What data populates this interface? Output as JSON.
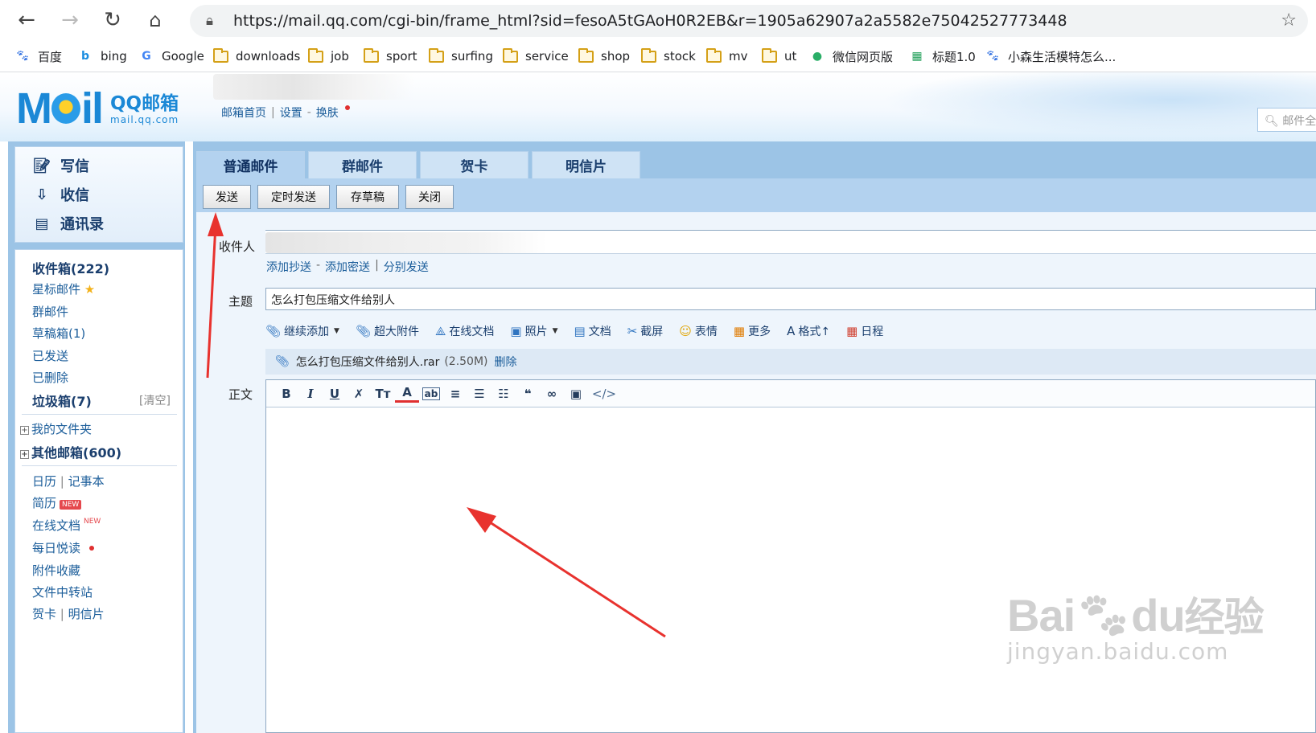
{
  "browser": {
    "url": "https://mail.qq.com/cgi-bin/frame_html?sid=fesoA5tGAoH0R2EB&r=1905a62907a2a5582e75042527773448",
    "bookmarks": [
      {
        "label": "百度",
        "icon": "baidu-paw-icon"
      },
      {
        "label": "bing",
        "icon": "bing-icon"
      },
      {
        "label": "Google",
        "icon": "google-icon"
      },
      {
        "label": "downloads",
        "icon": "folder-icon"
      },
      {
        "label": "job",
        "icon": "folder-icon"
      },
      {
        "label": "sport",
        "icon": "folder-icon"
      },
      {
        "label": "surfing",
        "icon": "folder-icon"
      },
      {
        "label": "service",
        "icon": "folder-icon"
      },
      {
        "label": "shop",
        "icon": "folder-icon"
      },
      {
        "label": "stock",
        "icon": "folder-icon"
      },
      {
        "label": "mv",
        "icon": "folder-icon"
      },
      {
        "label": "ut",
        "icon": "folder-icon"
      },
      {
        "label": "微信网页版",
        "icon": "wechat-icon"
      },
      {
        "label": "标题1.0",
        "icon": "sheet-icon"
      },
      {
        "label": "小森生活模特怎么...",
        "icon": "baidu-paw-icon"
      }
    ]
  },
  "header": {
    "logo_mail": "M",
    "logo_il": "il",
    "logo_name": "QQ邮箱",
    "logo_domain": "mail.qq.com",
    "links": {
      "home": "邮箱首页",
      "settings": "设置",
      "skin": "换肤"
    },
    "search_placeholder": "邮件全"
  },
  "sidebar": {
    "quick": {
      "compose": "写信",
      "inbox": "收信",
      "contacts": "通讯录"
    },
    "folders": {
      "inbox": "收件箱(222)",
      "starred": "星标邮件",
      "group": "群邮件",
      "drafts": "草稿箱(1)",
      "sent": "已发送",
      "deleted": "已删除",
      "spam": "垃圾箱(7)",
      "spam_clear": "[清空]",
      "my_folders": "我的文件夹",
      "other_mailboxes": "其他邮箱(600)"
    },
    "apps": {
      "calendar": "日历",
      "notes": "记事本",
      "resume": "简历",
      "resume_badge": "NEW",
      "docs": "在线文档",
      "docs_badge": "NEW",
      "daily": "每日悦读",
      "attachments": "附件收藏",
      "transfer": "文件中转站",
      "cards": "贺卡",
      "postcards": "明信片"
    }
  },
  "compose": {
    "tabs": [
      "普通邮件",
      "群邮件",
      "贺卡",
      "明信片"
    ],
    "buttons": {
      "send": "发送",
      "schedule": "定时发送",
      "draft": "存草稿",
      "close": "关闭"
    },
    "labels": {
      "to": "收件人",
      "subject": "主题",
      "body": "正文"
    },
    "recipient_links": {
      "cc": "添加抄送",
      "bcc": "添加密送",
      "separate": "分别发送"
    },
    "subject_value": "怎么打包压缩文件给别人",
    "attach_tools": [
      {
        "label": "继续添加",
        "icon": "paperclip-icon"
      },
      {
        "label": "超大附件",
        "icon": "large-attachment-icon"
      },
      {
        "label": "在线文档",
        "icon": "online-doc-icon"
      },
      {
        "label": "照片",
        "icon": "photo-icon"
      },
      {
        "label": "文档",
        "icon": "document-icon"
      },
      {
        "label": "截屏",
        "icon": "screenshot-icon"
      },
      {
        "label": "表情",
        "icon": "emoji-icon"
      },
      {
        "label": "更多",
        "icon": "more-icon"
      },
      {
        "label": "格式↑",
        "icon": "format-icon"
      },
      {
        "label": "日程",
        "icon": "calendar-icon"
      }
    ],
    "attachment": {
      "name": "怎么打包压缩文件给别人.rar",
      "size": "(2.50M)",
      "delete": "删除"
    },
    "editor_tools": [
      {
        "glyph": "B",
        "icon": "bold-icon"
      },
      {
        "glyph": "I",
        "icon": "italic-icon"
      },
      {
        "glyph": "U",
        "icon": "underline-icon"
      },
      {
        "glyph": "✗",
        "icon": "clear-format-icon"
      },
      {
        "glyph": "Tт",
        "icon": "font-size-icon"
      },
      {
        "glyph": "A",
        "icon": "font-color-icon"
      },
      {
        "glyph": "ab",
        "icon": "bg-color-icon"
      },
      {
        "glyph": "≡",
        "icon": "align-icon"
      },
      {
        "glyph": "☰",
        "icon": "list-icon"
      },
      {
        "glyph": "☷",
        "icon": "indent-icon"
      },
      {
        "glyph": "❝",
        "icon": "quote-icon"
      },
      {
        "glyph": "∞",
        "icon": "link-icon"
      },
      {
        "glyph": "▣",
        "icon": "insert-icon"
      },
      {
        "glyph": "</>",
        "icon": "source-code-icon"
      }
    ]
  },
  "watermark": {
    "brand": "Bai",
    "brand2": "du",
    "cn": "经验",
    "site": "jingyan.baidu.com"
  },
  "colors": {
    "accent": "#1b88d6",
    "panel_blue": "#9cc4e6",
    "arrow_red": "#e8322e"
  }
}
